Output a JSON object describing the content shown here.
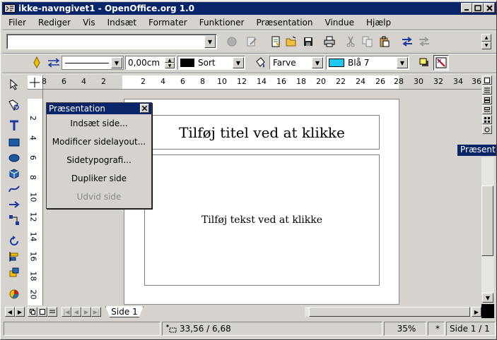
{
  "window": {
    "title": "ikke-navngivet1 - OpenOffice.org 1.0",
    "min_icon": "minimize-icon",
    "max_icon": "maximize-icon",
    "close_icon": "close-icon"
  },
  "menu": {
    "items": [
      "Filer",
      "Rediger",
      "Vis",
      "Indsæt",
      "Formater",
      "Funktioner",
      "Præsentation",
      "Vindue",
      "Hjælp"
    ]
  },
  "toolbar2": {
    "line_width": "0,00cm",
    "line_color": "Sort",
    "area_style": "Farve",
    "area_color": "Blå 7",
    "line_color_hex": "#000000",
    "area_color_hex": "#1ec8f0"
  },
  "ruler": {
    "h_ticks": [
      "8",
      "6",
      "4",
      "2",
      "2",
      "4",
      "6",
      "8",
      "10",
      "12",
      "14",
      "16",
      "18",
      "20",
      "22",
      "24",
      "26",
      "28",
      "30",
      "32",
      "34",
      "36"
    ],
    "v_ticks": [
      "2",
      "4",
      "6",
      "8",
      "10",
      "12",
      "14",
      "16",
      "18",
      "20"
    ]
  },
  "slide": {
    "title_placeholder": "Tilføj titel ved at klikke",
    "text_placeholder": "Tilføj tekst ved at klikke"
  },
  "palette": {
    "title": "Præsentation",
    "items": [
      {
        "label": "Indsæt side...",
        "enabled": true
      },
      {
        "label": "Modificer sidelayout...",
        "enabled": true
      },
      {
        "label": "Sidetypografi...",
        "enabled": true
      },
      {
        "label": "Dupliker side",
        "enabled": true
      },
      {
        "label": "Udvid side",
        "enabled": false
      }
    ]
  },
  "side_panel": {
    "label": "Præsent"
  },
  "tabs": {
    "active": "Side 1"
  },
  "status": {
    "position": "33,56 / 6,68",
    "zoom": "35%",
    "modified": "*",
    "page": "Side 1 / 1"
  }
}
